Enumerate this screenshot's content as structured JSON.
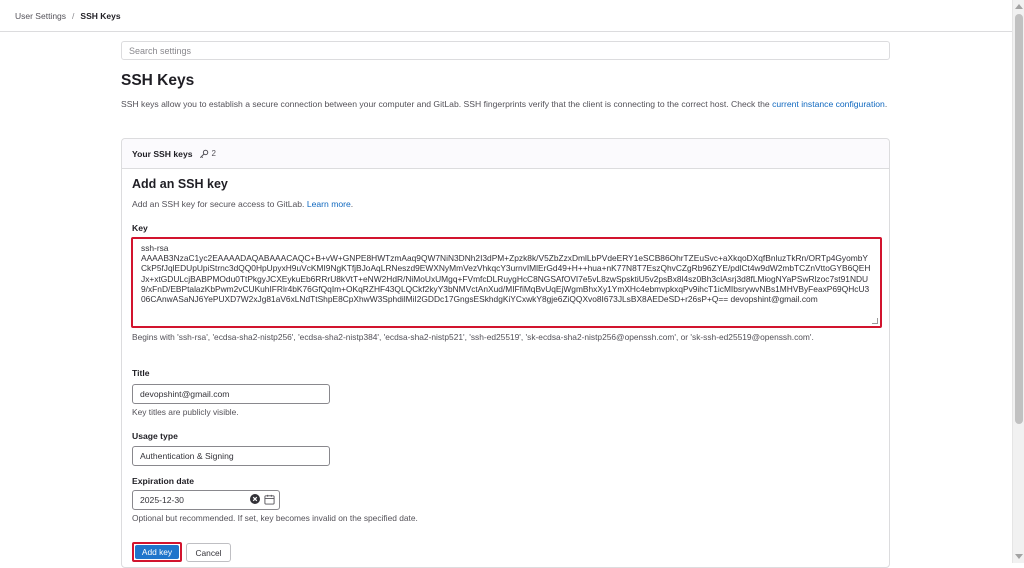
{
  "breadcrumb": {
    "parent": "User Settings",
    "separator": "/",
    "current": "SSH Keys"
  },
  "search": {
    "placeholder": "Search settings",
    "value": ""
  },
  "page": {
    "title": "SSH Keys",
    "description": "SSH keys allow you to establish a secure connection between your computer and GitLab. SSH fingerprints verify that the client is connecting to the correct host. Check the ",
    "description_link": "current instance configuration",
    "description_end": "."
  },
  "card": {
    "header": "Your SSH keys",
    "count": "2"
  },
  "form": {
    "title": "Add an SSH key",
    "subtitle": "Add an SSH key for secure access to GitLab. ",
    "subtitle_link": "Learn more",
    "subtitle_end": ".",
    "key_label": "Key",
    "key_value": "ssh-rsa\nAAAAB3NzaC1yc2EAAAADAQABAAACAQC+B+vW+GNPE8HWTzmAaq9QW7NiN3DNh2I3dPM+Zpzk8k/V5ZbZzxDmlLbPVdeERY1eSCB86OhrTZEuSvc+aXkqoDXqfBnluzTkRn/ORTp4GyombYCkP5fJqlEDUpUpiStrnc3dQQ0HpUpyxH9uVcKMI9NgKTfjBJoAqLRNeszd9EWXNyMmVezVhkqcY3urnvIMlErGd49+H++hua+nK77N8T7EszQhvCZgRb96ZYE/pdlCt4w9dW2mbTCZnVttoGYB6QEHJx+xtGDULcjBABPMOdu0TtPkgyJCXEykuEb6RRrU8kVtT+eNW2HdR/NiMoUxUMgq+FVmfcDLRuygHcC8NGSAfOVI7e5vL8zwSpsktiU5v2psBx8l4sz0Bh3clAsrj3d8fLMiogNYaPSwRlzoc7st91NDU9/xFnD/EBPtalazKbPwm2vCUKuhIFRlr4bK76GfQqIm+OKqRZHF43QLQCkf2kyY3bNMVctAnXud/MIFfiMqBvUqEjWgmBhxXy1YmXHc4ebmvpkxqPv9ihcT1icMIbsrywvNBs1MHVByFeaxP69QHcU306CAnwASaNJ6YePUXD7W2xJg81aV6xLNdTtShpE8CpXhwW3SphdilMiI2GDDc17GngsESkhdgKiYCxwkY8gje6ZiQQXvo8I673JLsBX8AEDeSD+r26sP+Q== devopshint@gmail.com",
    "key_help": "Begins with 'ssh-rsa', 'ecdsa-sha2-nistp256', 'ecdsa-sha2-nistp384', 'ecdsa-sha2-nistp521', 'ssh-ed25519', 'sk-ecdsa-sha2-nistp256@openssh.com', or 'sk-ssh-ed25519@openssh.com'.",
    "title_label": "Title",
    "title_value": "devopshint@gmail.com",
    "title_help": "Key titles are publicly visible.",
    "usage_label": "Usage type",
    "usage_value": "Authentication & Signing",
    "expiration_label": "Expiration date",
    "expiration_value": "2025-12-30",
    "expiration_help": "Optional but recommended. If set, key becomes invalid on the specified date.",
    "add_button": "Add key",
    "cancel_button": "Cancel"
  },
  "colors": {
    "highlight": "#d2142e",
    "primary": "#1f75cb",
    "link": "#1068bf"
  },
  "icons": {
    "key_count": "key-icon",
    "clear": "clear-circle-icon",
    "calendar": "calendar-icon"
  }
}
